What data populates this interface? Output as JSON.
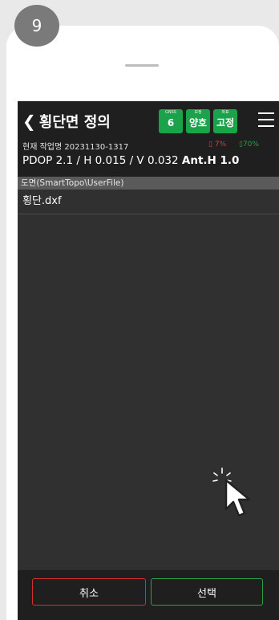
{
  "step_number": "9",
  "header": {
    "back_icon": "chevron-left-icon",
    "title": "횡단면 정의",
    "pills": [
      {
        "caption": "GNSS",
        "value": "6"
      },
      {
        "caption": "보정",
        "value": "양호"
      },
      {
        "caption": "좌표",
        "value": "고정"
      }
    ],
    "menu_icon": "hamburger-menu-icon",
    "job_label": "현재 작업명 20231130-1317",
    "battery_red": "7%",
    "battery_green": "70%",
    "status_text": "PDOP 2.1 / H 0.015 / V 0.032",
    "antenna_text": "Ant.H 1.0"
  },
  "path_label": "도면(SmartTopo\\UserFile)",
  "files": [
    "횡단.dxf"
  ],
  "buttons": {
    "cancel": "취소",
    "select": "선택"
  },
  "colors": {
    "accent_green": "#1aa34a",
    "cancel_red": "#d32f2f",
    "screen_bg": "#303030"
  }
}
